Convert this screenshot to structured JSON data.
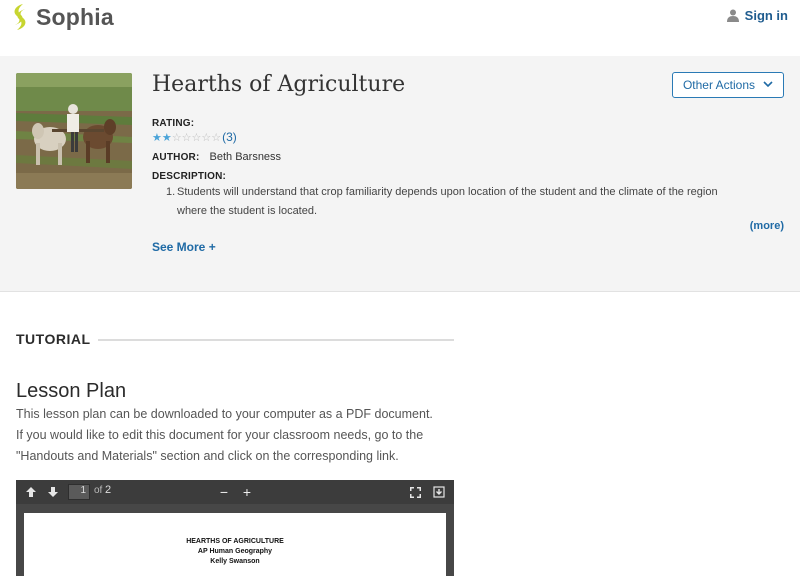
{
  "header": {
    "brand": "Sophia",
    "signin_label": "Sign in",
    "brand_color": "#c7d530"
  },
  "resource": {
    "title": "Hearths of Agriculture",
    "other_actions_label": "Other Actions",
    "rating_label": "RATING:",
    "rating_stars_filled": 2,
    "rating_stars_total": 7,
    "rating_count": "(3)",
    "author_label": "AUTHOR:",
    "author_name": "Beth Barsness",
    "description_label": "DESCRIPTION:",
    "description_number": "1.",
    "description_line1": "Students will understand that crop familiarity depends upon location of the student and the climate of the region",
    "description_line2": "where the student is located.",
    "more_label": "(more)",
    "see_more_label": "See More +"
  },
  "tutorial": {
    "heading": "TUTORIAL",
    "lesson_title": "Lesson Plan",
    "lesson_line1": "This lesson plan can be downloaded to your computer as a PDF document.",
    "lesson_line2": "If you would like to edit this document for your classroom needs, go to the",
    "lesson_line3": "\"Handouts and Materials\" section and click on the corresponding link."
  },
  "pdf_viewer": {
    "current_page": "1",
    "of_label": "of",
    "total_pages": "2",
    "zoom_out": "−",
    "zoom_in": "+",
    "doc_title": "HEARTHS OF AGRICULTURE",
    "doc_course": "AP Human Geography",
    "doc_author": "Kelly Swanson"
  },
  "colors": {
    "link": "#1f6aa5",
    "star_filled": "#4aa3d8",
    "banner_bg": "#f4f4f4"
  }
}
